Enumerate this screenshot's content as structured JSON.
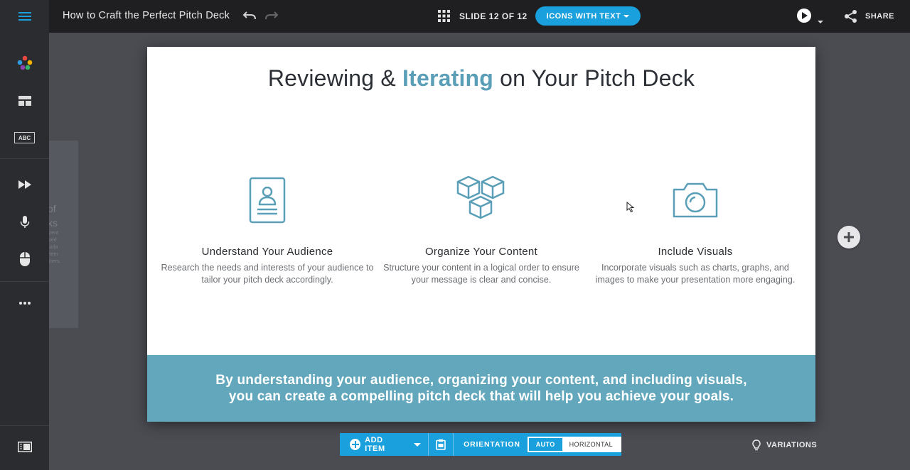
{
  "header": {
    "menu_icon": "hamburger-icon",
    "doc_title": "How to Craft the Perfect Pitch Deck",
    "slide_counter": "SLIDE 12 OF 12",
    "layout_button": "ICONS WITH TEXT",
    "share_label": "SHARE"
  },
  "sidebar": {
    "items": [
      {
        "icon": "palette-icon"
      },
      {
        "icon": "layout-icon"
      },
      {
        "icon": "text-icon",
        "label": "ABC"
      },
      {
        "icon": "fast-forward-icon"
      },
      {
        "icon": "microphone-icon"
      },
      {
        "icon": "mouse-icon"
      },
      {
        "icon": "more-icon"
      },
      {
        "icon": "notes-panel-icon"
      }
    ]
  },
  "ghost_slide": {
    "title_lines": [
      "of",
      "ks"
    ],
    "body_lines": [
      "trent",
      "ped",
      "uola",
      "hem",
      "tners."
    ]
  },
  "slide": {
    "title_pre": "Reviewing & ",
    "title_accent": "Iterating",
    "title_post": " on Your Pitch Deck",
    "cards": [
      {
        "icon": "id-card-icon",
        "title": "Understand Your Audience",
        "text": "Research the needs and interests of your audience to tailor your pitch deck accordingly."
      },
      {
        "icon": "cubes-icon",
        "title": "Organize Your Content",
        "text": "Structure your content in a logical order to ensure your message is clear and concise."
      },
      {
        "icon": "camera-icon",
        "title": "Include Visuals",
        "text": "Incorporate visuals such as charts, graphs, and images to make your presentation more engaging."
      }
    ],
    "footer_line1": "By understanding your audience, organizing your content, and including visuals,",
    "footer_line2": "you can create a compelling pitch deck that will help you achieve your goals."
  },
  "bottom_toolbar": {
    "add_item_label": "ADD ITEM",
    "orientation_label": "ORIENTATION",
    "orientation_options": [
      "AUTO",
      "HORIZONTAL"
    ],
    "orientation_selected": "AUTO"
  },
  "variations_label": "VARIATIONS",
  "colors": {
    "accent": "#5a9fb7",
    "toolbar_blue": "#1aa0dc",
    "footer_band": "#63a7bd"
  }
}
